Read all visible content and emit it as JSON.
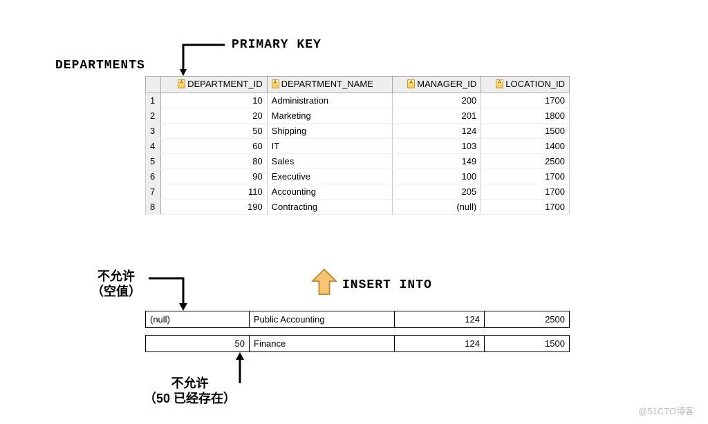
{
  "labels": {
    "primary_key": "PRIMARY KEY",
    "table_name": "DEPARTMENTS",
    "insert_into": "INSERT INTO",
    "not_allowed_null_line1": "不允许",
    "not_allowed_null_line2": "（空值）",
    "not_allowed_dup_line1": "不允许",
    "not_allowed_dup_line2": "（50 已经存在）"
  },
  "columns": {
    "c1": "DEPARTMENT_ID",
    "c2": "DEPARTMENT_NAME",
    "c3": "MANAGER_ID",
    "c4": "LOCATION_ID"
  },
  "rows": [
    {
      "n": "1",
      "id": "10",
      "name": "Administration",
      "mgr": "200",
      "loc": "1700"
    },
    {
      "n": "2",
      "id": "20",
      "name": "Marketing",
      "mgr": "201",
      "loc": "1800"
    },
    {
      "n": "3",
      "id": "50",
      "name": "Shipping",
      "mgr": "124",
      "loc": "1500"
    },
    {
      "n": "4",
      "id": "60",
      "name": "IT",
      "mgr": "103",
      "loc": "1400"
    },
    {
      "n": "5",
      "id": "80",
      "name": "Sales",
      "mgr": "149",
      "loc": "2500"
    },
    {
      "n": "6",
      "id": "90",
      "name": "Executive",
      "mgr": "100",
      "loc": "1700"
    },
    {
      "n": "7",
      "id": "110",
      "name": "Accounting",
      "mgr": "205",
      "loc": "1700"
    },
    {
      "n": "8",
      "id": "190",
      "name": "Contracting",
      "mgr": "(null)",
      "loc": "1700"
    }
  ],
  "insert_rows": {
    "r1": {
      "id": "(null)",
      "name": "Public Accounting",
      "mgr": "124",
      "loc": "2500"
    },
    "r2": {
      "id": "50",
      "name": "Finance",
      "mgr": "124",
      "loc": "1500"
    }
  },
  "watermark": "@51CTO博客"
}
